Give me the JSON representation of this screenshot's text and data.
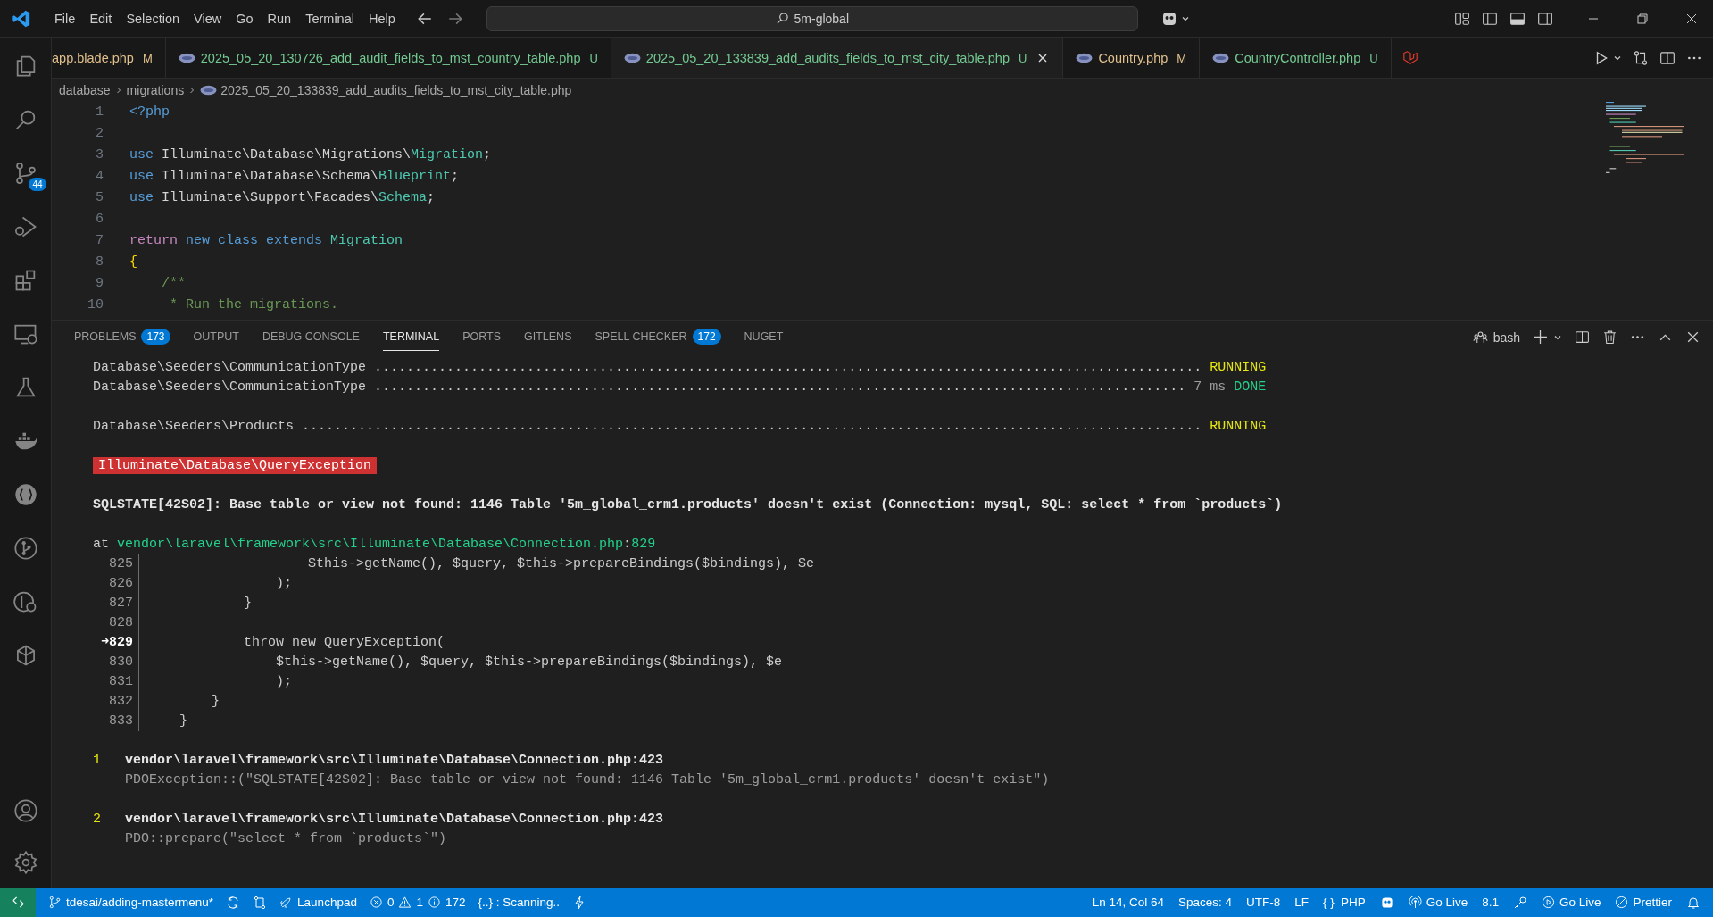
{
  "menu": [
    "File",
    "Edit",
    "Selection",
    "View",
    "Go",
    "Run",
    "Terminal",
    "Help"
  ],
  "search": {
    "value": "5m-global"
  },
  "activity_bar": {
    "source_control_badge": "44"
  },
  "tabs": [
    {
      "label": "app.blade.php",
      "status": "M",
      "color": "#e2c08d",
      "selected": false,
      "file_icon": false,
      "closable": false
    },
    {
      "label": "2025_05_20_130726_add_audit_fields_to_mst_country_table.php",
      "status": "U",
      "color": "#73c991",
      "selected": false,
      "file_icon": true,
      "closable": false
    },
    {
      "label": "2025_05_20_133839_add_audits_fields_to_mst_city_table.php",
      "status": "U",
      "color": "#73c991",
      "selected": true,
      "file_icon": true,
      "closable": true
    },
    {
      "label": "Country.php",
      "status": "M",
      "color": "#e2c08d",
      "selected": false,
      "file_icon": true,
      "closable": false
    },
    {
      "label": "CountryController.php",
      "status": "U",
      "color": "#73c991",
      "selected": false,
      "file_icon": true,
      "closable": false
    }
  ],
  "breadcrumb": {
    "folders": [
      "database",
      "migrations"
    ],
    "file": "2025_05_20_133839_add_audits_fields_to_mst_city_table.php"
  },
  "editor_lines": [
    {
      "number": "1",
      "tokens": [
        {
          "t": "<?php",
          "kind": "tag"
        }
      ]
    },
    {
      "number": "2"
    },
    {
      "number": "3",
      "tokens": [
        {
          "t": "use",
          "kind": "keyword"
        },
        {
          "t": " Illuminate\\Database\\Migrations\\",
          "kind": "plain"
        },
        {
          "t": "Migration",
          "kind": "type"
        },
        {
          "t": ";",
          "kind": "plain"
        }
      ]
    },
    {
      "number": "4",
      "tokens": [
        {
          "t": "use",
          "kind": "keyword"
        },
        {
          "t": " Illuminate\\Database\\Schema\\",
          "kind": "plain"
        },
        {
          "t": "Blueprint",
          "kind": "type"
        },
        {
          "t": ";",
          "kind": "plain"
        }
      ]
    },
    {
      "number": "5",
      "tokens": [
        {
          "t": "use",
          "kind": "keyword"
        },
        {
          "t": " Illuminate\\Support\\Facades\\",
          "kind": "plain"
        },
        {
          "t": "Schema",
          "kind": "type"
        },
        {
          "t": ";",
          "kind": "plain"
        }
      ]
    },
    {
      "number": "6"
    },
    {
      "number": "7",
      "tokens": [
        {
          "t": "return",
          "kind": "control"
        },
        {
          "t": " new class extends ",
          "kind": "keyword"
        },
        {
          "t": "Migration",
          "kind": "type"
        }
      ]
    },
    {
      "number": "8",
      "tokens": [
        {
          "t": "{",
          "kind": "brace"
        }
      ]
    },
    {
      "number": "9",
      "tokens": [
        {
          "t": "    /**",
          "kind": "comment"
        }
      ]
    },
    {
      "number": "10",
      "tokens": [
        {
          "t": "     * Run the migrations.",
          "kind": "comment"
        }
      ]
    }
  ],
  "panel_tabs": [
    {
      "label": "PROBLEMS",
      "badge": "173",
      "selected": false
    },
    {
      "label": "OUTPUT",
      "selected": false
    },
    {
      "label": "DEBUG CONSOLE",
      "selected": false
    },
    {
      "label": "TERMINAL",
      "selected": true
    },
    {
      "label": "PORTS",
      "selected": false
    },
    {
      "label": "GITLENS",
      "selected": false
    },
    {
      "label": "SPELL CHECKER",
      "badge": "172",
      "selected": false
    },
    {
      "label": "NUGET",
      "selected": false
    }
  ],
  "shell": "bash",
  "terminal": {
    "task_groups": [
      [
        {
          "name": "Database\\Seeders\\CommunicationType",
          "dots": ".......................................................................................................",
          "status": "RUNNING",
          "kind": "running"
        },
        {
          "name": "Database\\Seeders\\CommunicationType",
          "dots": ".....................................................................................................",
          "duration": "7 ms",
          "status": "DONE",
          "kind": "done"
        }
      ],
      [
        {
          "name": "Database\\Seeders\\Products",
          "dots": "................................................................................................................",
          "status": "RUNNING",
          "kind": "running"
        }
      ]
    ],
    "exception": "Illuminate\\Database\\QueryException",
    "message": "SQLSTATE[42S02]: Base table or view not found: 1146 Table '5m_global_crm1.products' doesn't exist (Connection: mysql, SQL: select * from `products`)",
    "location": {
      "prefix": "at",
      "path": "vendor\\laravel\\framework\\src\\Illuminate\\Database\\Connection.php",
      "separator": ":",
      "line": "829"
    },
    "snippet": [
      {
        "number": "825",
        "code": "                    $this->getName(), $query, $this->prepareBindings($bindings), $e",
        "current": false
      },
      {
        "number": "826",
        "code": "                );",
        "current": false
      },
      {
        "number": "827",
        "code": "            }",
        "current": false
      },
      {
        "number": "828",
        "current": false
      },
      {
        "marker": "➜",
        "number": "829",
        "code": "            throw new QueryException(",
        "current": true
      },
      {
        "number": "830",
        "code": "                $this->getName(), $query, $this->prepareBindings($bindings), $e",
        "current": false
      },
      {
        "number": "831",
        "code": "                );",
        "current": false
      },
      {
        "number": "832",
        "code": "        }",
        "current": false
      },
      {
        "number": "833",
        "code": "    }",
        "current": false
      }
    ],
    "frames": [
      {
        "index": "1",
        "path": "vendor\\laravel\\framework\\src\\Illuminate\\Database\\Connection.php:423",
        "detail": "PDOException::(\"SQLSTATE[42S02]: Base table or view not found: 1146 Table '5m_global_crm1.products' doesn't exist\")"
      },
      {
        "index": "2",
        "path": "vendor\\laravel\\framework\\src\\Illuminate\\Database\\Connection.php:423",
        "detail": "PDO::prepare(\"select * from `products`\")"
      }
    ]
  },
  "status_bar": {
    "branch": "tdesai/adding-mastermenu*",
    "launchpad": "Launchpad",
    "errors": "0",
    "warnings": "1",
    "infos": "172",
    "scanning": "{..} : Scanning..",
    "position": "Ln 14, Col 64",
    "indentation": "Spaces: 4",
    "encoding": "UTF-8",
    "eol": "LF",
    "language_glyph": "{ }",
    "language": "PHP",
    "go_live": "Go Live",
    "php_version": "8.1",
    "go_live_2": "Go Live",
    "prettier": "Prettier"
  }
}
